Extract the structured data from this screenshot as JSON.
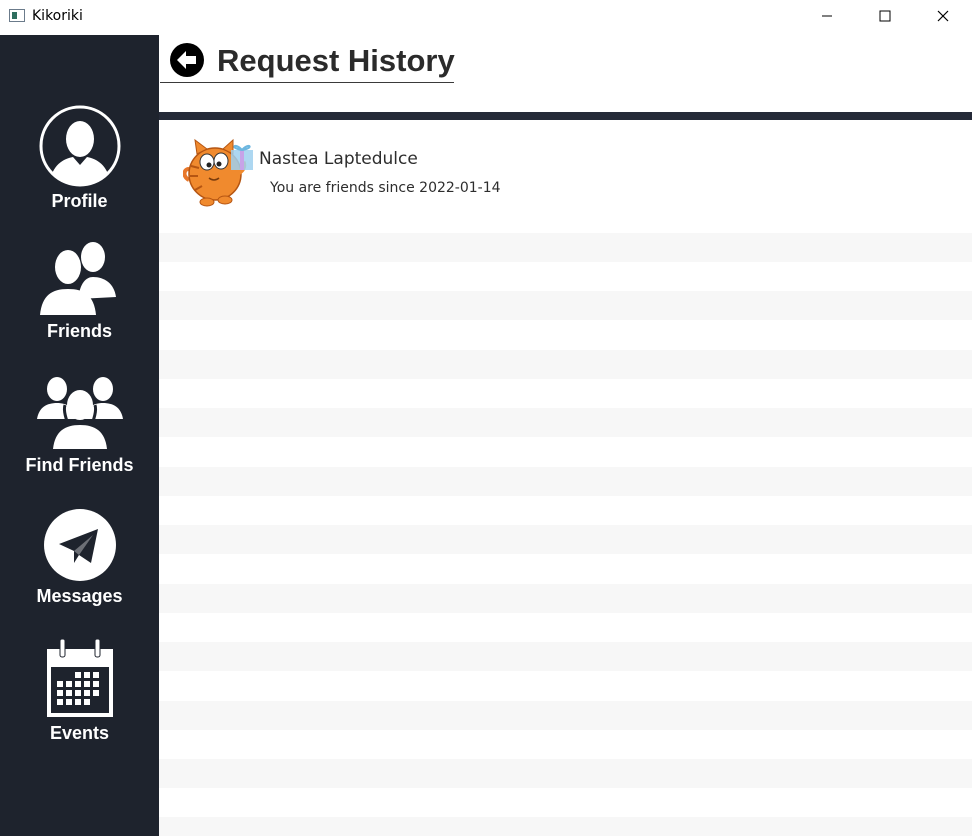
{
  "window": {
    "title": "Kikoriki"
  },
  "sidebar": {
    "items": [
      {
        "label": "Profile",
        "icon": "profile-icon"
      },
      {
        "label": "Friends",
        "icon": "friends-icon"
      },
      {
        "label": "Find Friends",
        "icon": "find-friends-icon"
      },
      {
        "label": "Messages",
        "icon": "messages-icon"
      },
      {
        "label": "Events",
        "icon": "calendar-icon"
      }
    ]
  },
  "header": {
    "title": "Request History",
    "back_icon": "back-arrow-icon"
  },
  "requests": [
    {
      "name": "Nastea Laptedulce",
      "status": "You are friends since 2022-01-14",
      "avatar": "cat-avatar-icon"
    }
  ],
  "colors": {
    "sidebar_bg": "#1e232d",
    "header_bar": "#252a38",
    "stripe": "#f7f7f7",
    "text": "#2d2d2d"
  }
}
